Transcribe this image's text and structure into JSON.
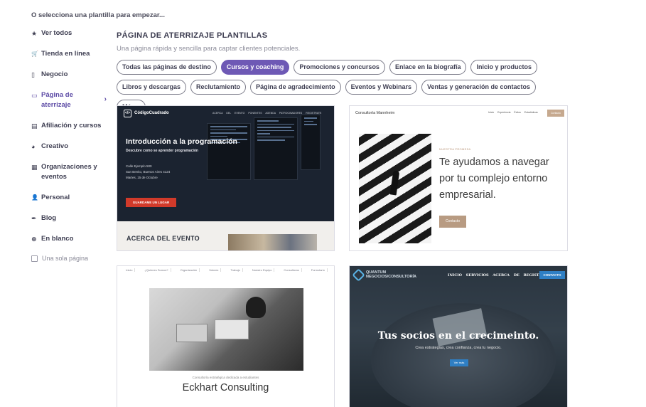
{
  "prompt": "O selecciona una plantilla para empezar...",
  "sidebar": {
    "items": [
      {
        "label": "Ver todos",
        "icon": "★"
      },
      {
        "label": "Tienda en línea",
        "icon": "🛒"
      },
      {
        "label": "Negocio",
        "icon": "▯"
      },
      {
        "label": "Página de aterrizaje",
        "icon": "▭",
        "active": true
      },
      {
        "label": "Afiliación y cursos",
        "icon": "▤"
      },
      {
        "label": "Creativo",
        "icon": "◕"
      },
      {
        "label": "Organizaciones y eventos",
        "icon": "▦"
      },
      {
        "label": "Personal",
        "icon": "👤"
      },
      {
        "label": "Blog",
        "icon": "✒"
      },
      {
        "label": "En blanco",
        "icon": "⊕"
      }
    ],
    "chevron": "›",
    "single_page_label": "Una sola página"
  },
  "main": {
    "title": "PÁGINA DE ATERRIZAJE PLANTILLAS",
    "subtitle": "Una página rápida y sencilla para captar clientes potenciales.",
    "chips": [
      {
        "label": "Todas las páginas de destino"
      },
      {
        "label": "Cursos y coaching",
        "active": true
      },
      {
        "label": "Promociones y concursos"
      },
      {
        "label": "Enlace en la biografía"
      },
      {
        "label": "Inicio y productos"
      },
      {
        "label": "Libros y descargas"
      },
      {
        "label": "Reclutamiento"
      },
      {
        "label": "Página de agradecimiento"
      },
      {
        "label": "Eventos y Webinars"
      },
      {
        "label": "Ventas y generación de contactos"
      },
      {
        "label": "Más..."
      }
    ]
  },
  "cards": {
    "c1": {
      "logo": "</>",
      "brand": "CódigoCuadrado",
      "nav": "ACERCA DEL EVENTO   PONENTES   AGENDA   PATROCINADORES   REGISTRATE",
      "headline": "Introducción a la programación",
      "subhead": "Descubre como se aprender programación",
      "addr1": "Calle Ejemplo 500",
      "addr2": "San Benito, Buenos Aires 4124",
      "addr3": "Martes, 15 de Octubre",
      "cta": "GUARDAME UN LUGAR",
      "about": "ACERCA DEL EVENTO"
    },
    "c2": {
      "brand": "Consultoría Mannheim",
      "nav": "Inicio   Experiencia   Éxitos   Estadísticas",
      "nav_button": "Contacto",
      "eyebrow": "NUESTRA PROMESA",
      "headline": "Te ayudamos a navegar por tu complejo entorno empresarial.",
      "cta": "Contacto"
    },
    "c3": {
      "nav": [
        "Inicio",
        "¿Quienes Somos?",
        "Organización",
        "Valores",
        "Trabajo",
        "Nuestro Equipo",
        "Consultoras",
        "Formulario"
      ],
      "small": "Consultoría estratégica dedicada a estudiantes",
      "name": "Eckhart Consulting"
    },
    "c4": {
      "brand1": "QUANTUM",
      "brand2": "NEGOCIOS/CONSULTORÍA",
      "nav": "INICIO  SERVICIOS  ACERCA DE  REGISTRATE",
      "nav_button": "CONTACTO",
      "headline": "Tus socios en el crecimeinto.",
      "subhead": "Crea estrategias, crea confianza, crea tu negocio.",
      "cta": "Ver más"
    }
  },
  "colors": {
    "accent": "#6e59b5",
    "red_cta": "#d13a2a",
    "blue_cta": "#2f7fc4",
    "tan": "#b89b82"
  }
}
